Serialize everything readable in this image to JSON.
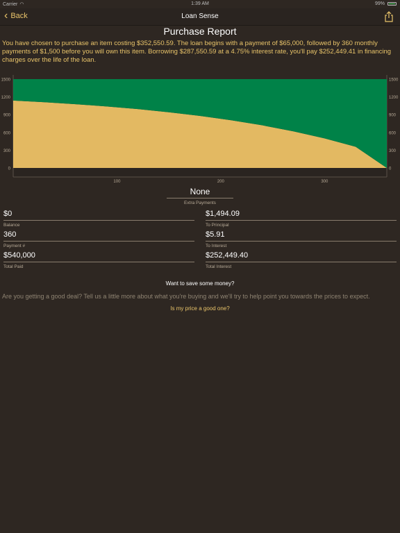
{
  "status_bar": {
    "carrier": "Carrier",
    "time": "1:39 AM",
    "battery": "99%"
  },
  "nav": {
    "back_label": "Back",
    "title": "Loan Sense",
    "share_icon": "share-icon"
  },
  "report": {
    "title": "Purchase Report",
    "summary": "You have chosen to purchase an item costing $352,550.59. The loan begins with a payment of $65,000, followed by 360 monthly payments of $1,500 before you will own this item. Borrowing $287,550.59 at a 4.75% interest rate, you'll pay $252,449.41 in financing charges over the life of the loan."
  },
  "colors": {
    "background": "#2e2722",
    "accent": "#e9c46a",
    "principal": "#e8bd64",
    "interest": "#00854a"
  },
  "chart_data": {
    "type": "area",
    "stacked": true,
    "x": [
      0,
      30,
      60,
      90,
      120,
      150,
      180,
      210,
      240,
      270,
      300,
      330,
      360
    ],
    "series": [
      {
        "name": "",
        "color": "#e8bd64",
        "values": [
          1138,
          1110,
          1077,
          1039,
          994,
          941,
          879,
          806,
          720,
          618,
          499,
          358,
          0
        ]
      },
      {
        "name": "",
        "color": "#00854a",
        "values": [
          362,
          390,
          423,
          461,
          506,
          559,
          621,
          694,
          780,
          882,
          1001,
          1142,
          1500
        ]
      }
    ],
    "xticks": [
      "100",
      "200",
      "300"
    ],
    "xtick_values": [
      100,
      200,
      300
    ],
    "yticks_left": [
      "1500",
      "1200",
      "900",
      "600",
      "300",
      "0"
    ],
    "yticks_right": [
      "1500",
      "1200",
      "900",
      "600",
      "300",
      "0"
    ],
    "ytick_values": [
      1500,
      1200,
      900,
      600,
      300,
      0
    ],
    "xlim": [
      0,
      360
    ],
    "ylim": [
      0,
      1500
    ],
    "grid": false
  },
  "extra_payments": {
    "value": "None",
    "label": "Extra Payments"
  },
  "fields": {
    "balance": {
      "value": "$0",
      "label": "Balance"
    },
    "to_principal": {
      "value": "$1,494.09",
      "label": "To Principal"
    },
    "payment_number": {
      "value": "360",
      "label": "Payment #"
    },
    "to_interest": {
      "value": "$5.91",
      "label": "To Interest"
    },
    "total_paid": {
      "value": "$540,000",
      "label": "Total Paid"
    },
    "total_interest": {
      "value": "$252,449.40",
      "label": "Total Interest"
    }
  },
  "save": {
    "heading": "Want to save some money?",
    "text": "Are you getting a good deal? Tell us a little more about what you're buying and we'll try to help point you towards the prices to expect.",
    "link": "Is my price a good one?"
  }
}
